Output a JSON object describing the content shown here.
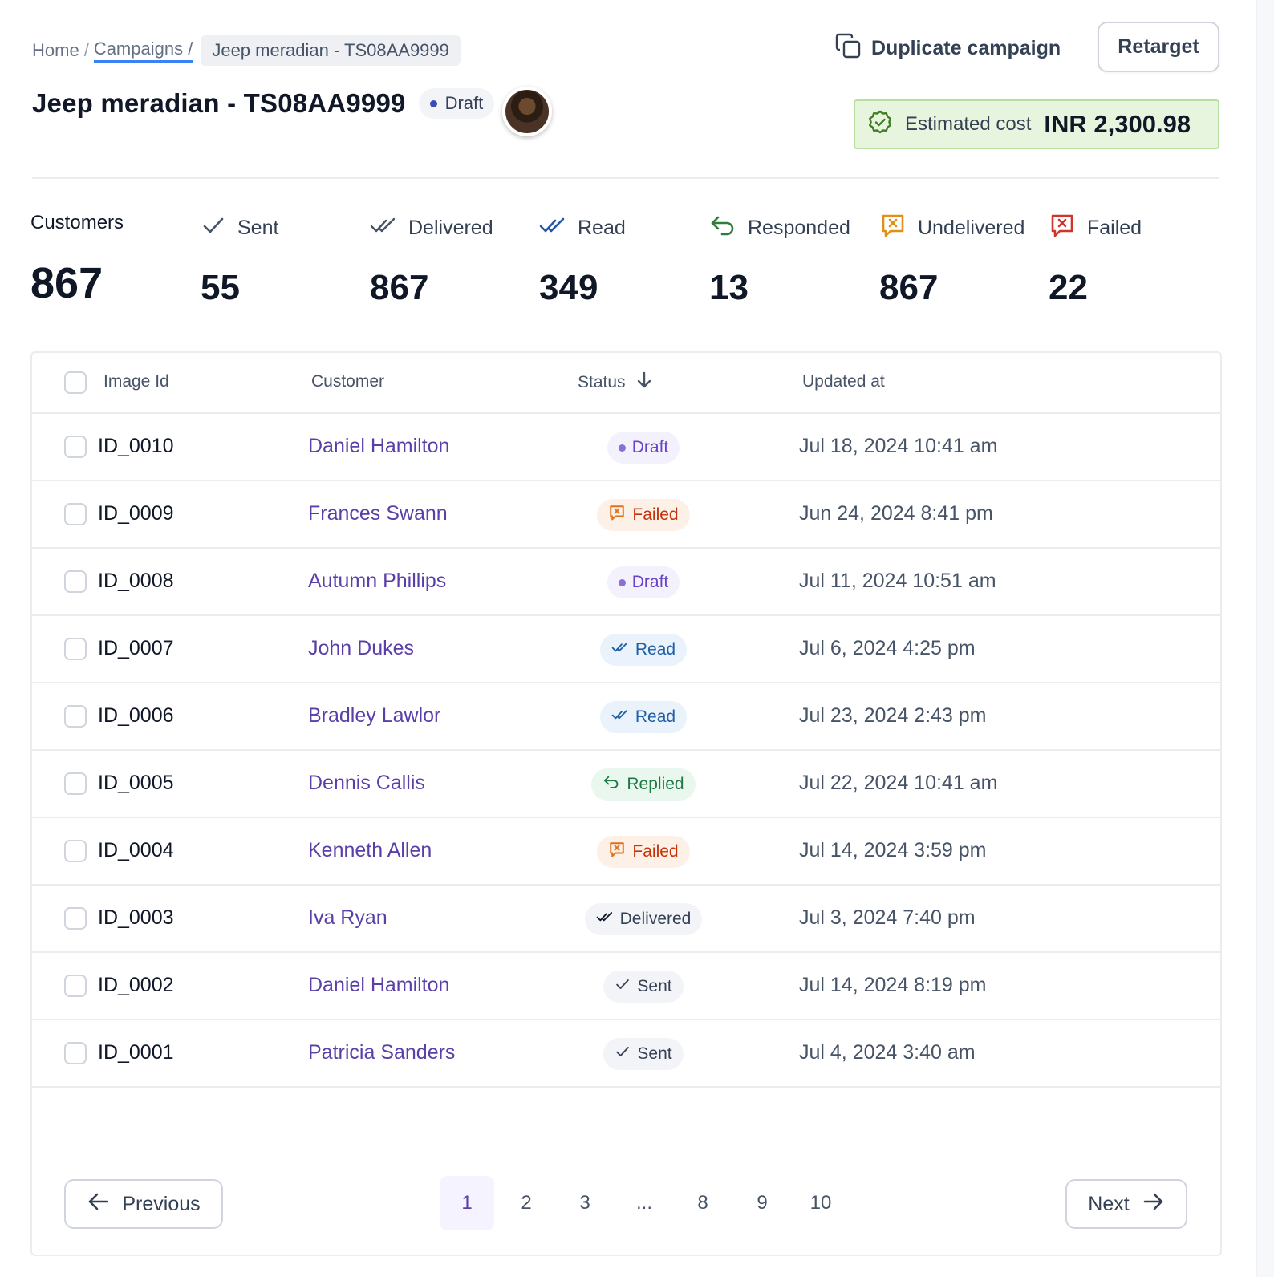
{
  "breadcrumb": {
    "home": "Home",
    "sep1": "/",
    "campaigns": "Campaigns /",
    "current": "Jeep meradian - TS08AA9999"
  },
  "header": {
    "duplicate_label": "Duplicate campaign",
    "retarget_label": "Retarget",
    "title": "Jeep meradian - TS08AA9999",
    "status": "Draft",
    "estimated_cost_label": "Estimated cost",
    "estimated_cost_value": "INR 2,300.98"
  },
  "stats": {
    "customers": {
      "label": "Customers",
      "value": "867"
    },
    "sent": {
      "label": "Sent",
      "value": "55"
    },
    "delivered": {
      "label": "Delivered",
      "value": "867"
    },
    "read": {
      "label": "Read",
      "value": "349"
    },
    "responded": {
      "label": "Responded",
      "value": "13"
    },
    "undelivered": {
      "label": "Undelivered",
      "value": "867"
    },
    "failed": {
      "label": "Failed",
      "value": "22"
    }
  },
  "table": {
    "columns": {
      "image_id": "Image Id",
      "customer": "Customer",
      "status": "Status",
      "updated_at": "Updated at"
    },
    "rows": [
      {
        "id": "ID_0010",
        "customer": "Daniel Hamilton",
        "status": "Draft",
        "updated": "Jul 18, 2024 10:41 am"
      },
      {
        "id": "ID_0009",
        "customer": "Frances Swann",
        "status": "Failed",
        "updated": "Jun 24, 2024 8:41 pm"
      },
      {
        "id": "ID_0008",
        "customer": "Autumn Phillips",
        "status": "Draft",
        "updated": "Jul 11, 2024 10:51 am"
      },
      {
        "id": "ID_0007",
        "customer": "John Dukes",
        "status": "Read",
        "updated": "Jul 6, 2024 4:25 pm"
      },
      {
        "id": "ID_0006",
        "customer": "Bradley Lawlor",
        "status": "Read",
        "updated": "Jul 23, 2024 2:43 pm"
      },
      {
        "id": "ID_0005",
        "customer": "Dennis Callis",
        "status": "Replied",
        "updated": "Jul 22, 2024 10:41 am"
      },
      {
        "id": "ID_0004",
        "customer": "Kenneth Allen",
        "status": "Failed",
        "updated": "Jul 14, 2024 3:59 pm"
      },
      {
        "id": "ID_0003",
        "customer": "Iva Ryan",
        "status": "Delivered",
        "updated": "Jul 3, 2024 7:40 pm"
      },
      {
        "id": "ID_0002",
        "customer": "Daniel Hamilton",
        "status": "Sent",
        "updated": "Jul 14, 2024 8:19 pm"
      },
      {
        "id": "ID_0001",
        "customer": "Patricia Sanders",
        "status": "Sent",
        "updated": "Jul 4, 2024 3:40 am"
      }
    ]
  },
  "pagination": {
    "previous_label": "Previous",
    "next_label": "Next",
    "pages": [
      "1",
      "2",
      "3",
      "...",
      "8",
      "9",
      "10"
    ],
    "current": "1"
  },
  "colors": {
    "accent_purple": "#5b3fa8",
    "estimated_cost_bg": "#e8f5de",
    "failed": "#c4320a",
    "read": "#1f5fa8",
    "replied": "#1f7a43"
  },
  "icons": {
    "duplicate": "copy-icon",
    "cost": "verified-badge-icon",
    "sent": "check-icon",
    "delivered": "double-check-icon",
    "read": "double-check-icon",
    "responded": "reply-arrow-icon",
    "undelivered": "message-x-icon",
    "failed": "message-x-icon",
    "sort": "arrow-down-icon",
    "previous": "arrow-left-icon",
    "next": "arrow-right-icon"
  }
}
